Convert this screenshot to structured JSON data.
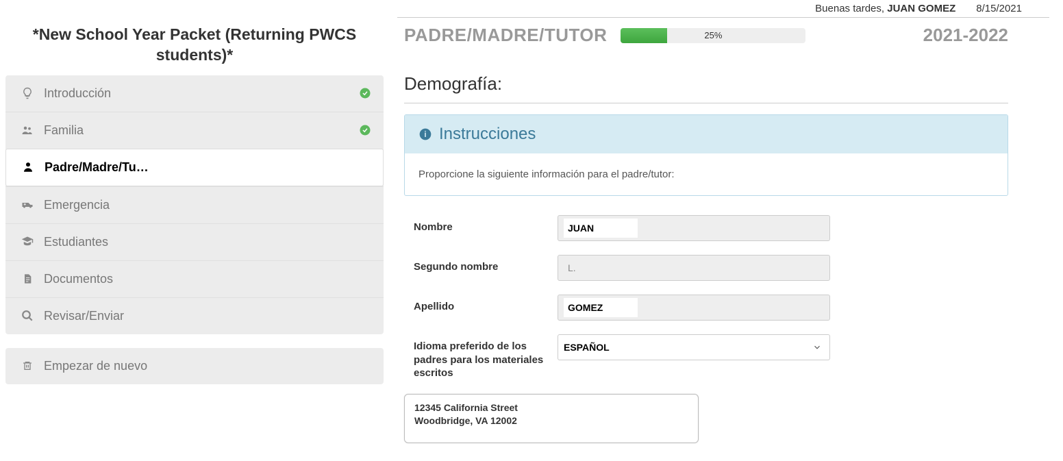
{
  "header": {
    "greeting": "Buenas tardes,",
    "username": "JUAN GOMEZ",
    "date": "8/15/2021"
  },
  "sidebar": {
    "title": "*New School Year Packet (Returning PWCS students)*",
    "items": [
      {
        "label": "Introducción",
        "completed": true
      },
      {
        "label": "Familia",
        "completed": true
      },
      {
        "label": "Padre/Madre/Tu…",
        "active": true
      },
      {
        "label": "Emergencia"
      },
      {
        "label": "Estudiantes"
      },
      {
        "label": "Documentos"
      },
      {
        "label": "Revisar/Enviar"
      }
    ],
    "restart_label": "Empezar de nuevo"
  },
  "main": {
    "breadcrumb": "PADRE/MADRE/TUTOR",
    "progress_pct": "25%",
    "progress_width": "25%",
    "year": "2021-2022",
    "section_title": "Demografía:",
    "instructions_title": "Instrucciones",
    "instructions_body": "Proporcione la siguiente información para el padre/tutor:",
    "form": {
      "nombre_label": "Nombre",
      "nombre_value": "JUAN",
      "segundo_label": "Segundo nombre",
      "segundo_value": "L.",
      "apellido_label": "Apellido",
      "apellido_value": "GOMEZ",
      "idioma_label": "Idioma preferido de los padres para los materiales escritos",
      "idioma_value": "ESPAÑOL"
    },
    "address": {
      "line1": "12345 California Street",
      "line2": "Woodbridge, VA 12002"
    }
  }
}
